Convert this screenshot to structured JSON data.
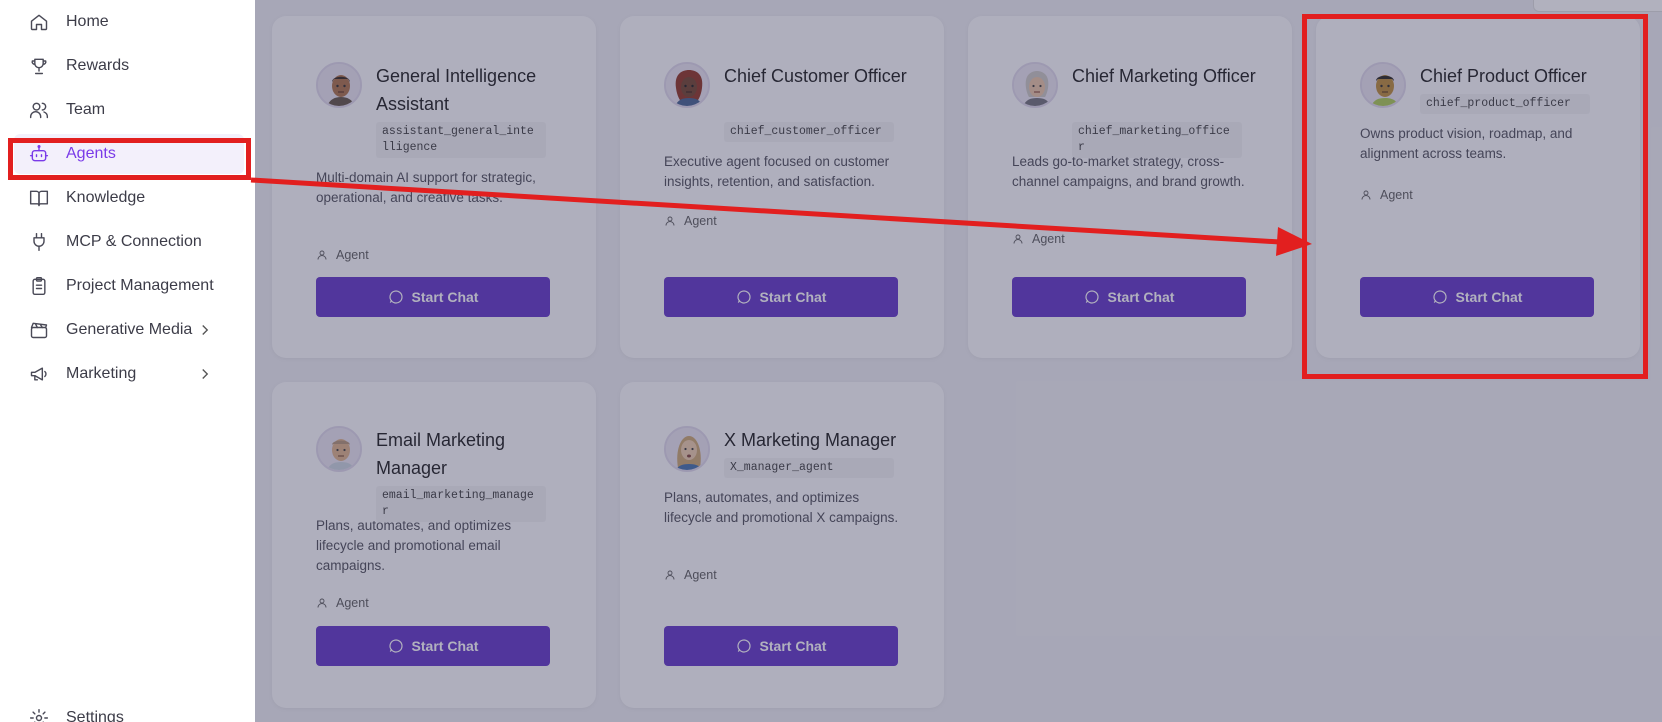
{
  "sidebar": {
    "items": [
      {
        "label": "Home",
        "icon": "home-icon"
      },
      {
        "label": "Rewards",
        "icon": "trophy-icon"
      },
      {
        "label": "Team",
        "icon": "users-icon"
      },
      {
        "label": "Agents",
        "icon": "robot-icon",
        "active": true
      },
      {
        "label": "Knowledge",
        "icon": "book-icon"
      },
      {
        "label": "MCP & Connection",
        "icon": "plug-icon"
      },
      {
        "label": "Project Management",
        "icon": "clipboard-icon"
      },
      {
        "label": "Generative Media",
        "icon": "clapperboard-icon",
        "has_submenu": true
      },
      {
        "label": "Marketing",
        "icon": "megaphone-icon",
        "has_submenu": true
      }
    ],
    "settings_label": "Settings"
  },
  "agents": [
    {
      "title": "General Intelligence Assistant",
      "code": "assistant_general_intelligence",
      "desc": "Multi-domain AI support for strategic, operational, and creative tasks.",
      "role": "Agent",
      "button": "Start Chat"
    },
    {
      "title": "Chief Customer Officer",
      "code": "chief_customer_officer",
      "desc": "Executive agent focused on customer insights, retention, and satisfaction.",
      "role": "Agent",
      "button": "Start Chat"
    },
    {
      "title": "Chief Marketing Officer",
      "code": "chief_marketing_officer",
      "desc": "Leads go-to-market strategy, cross-channel campaigns, and brand growth.",
      "role": "Agent",
      "button": "Start Chat"
    },
    {
      "title": "Chief Product Officer",
      "code": "chief_product_officer",
      "desc": "Owns product vision, roadmap, and alignment across teams.",
      "role": "Agent",
      "button": "Start Chat"
    },
    {
      "title": "Email Marketing Manager",
      "code": "email_marketing_manager",
      "desc": "Plans, automates, and optimizes lifecycle and promotional email campaigns.",
      "role": "Agent",
      "button": "Start Chat"
    },
    {
      "title": "X Marketing Manager",
      "code": "X_manager_agent",
      "desc": "Plans, automates, and optimizes lifecycle and promotional X campaigns.",
      "role": "Agent",
      "button": "Start Chat"
    }
  ],
  "colors": {
    "accent": "#5b2bc4",
    "active_nav": "#7a3be8",
    "annotation": "#e21f1f"
  }
}
